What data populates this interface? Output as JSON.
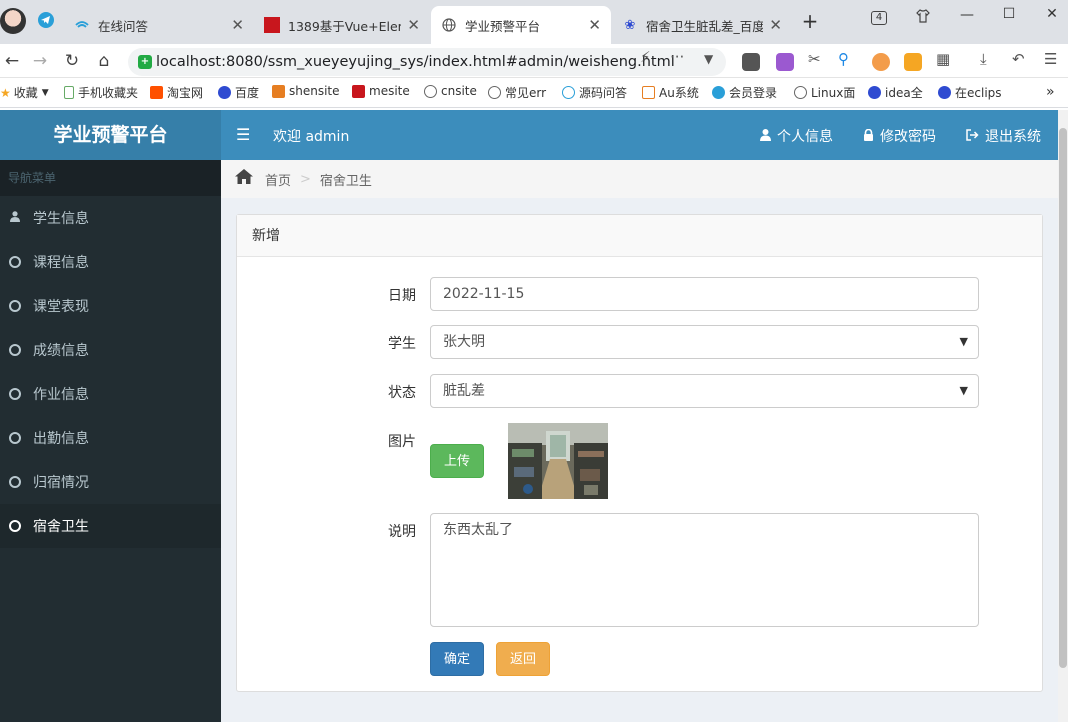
{
  "browser": {
    "tabs": [
      {
        "title": "在线问答"
      },
      {
        "title": "1389基于Vue+Eleme"
      },
      {
        "title": "学业预警平台"
      },
      {
        "title": "宿舍卫生脏乱差_百度"
      }
    ],
    "tab_count": "4",
    "url": "localhost:8080/ssm_xueyeyujing_sys/index.html#admin/weisheng.html",
    "bookmarks": [
      "收藏",
      "手机收藏夹",
      "淘宝网",
      "百度",
      "shensite",
      "mesite",
      "cnsite",
      "常见err",
      "源码问答",
      "Au系统",
      "会员登录",
      "Linux面",
      "idea全",
      "在eclips"
    ]
  },
  "header": {
    "brand": "学业预警平台",
    "welcome": "欢迎 admin",
    "profile": "个人信息",
    "change_password": "修改密码",
    "logout": "退出系统"
  },
  "sidebar": {
    "header": "导航菜单",
    "items": [
      {
        "label": "学生信息"
      },
      {
        "label": "课程信息"
      },
      {
        "label": "课堂表现"
      },
      {
        "label": "成绩信息"
      },
      {
        "label": "作业信息"
      },
      {
        "label": "出勤信息"
      },
      {
        "label": "归宿情况"
      },
      {
        "label": "宿舍卫生"
      }
    ]
  },
  "breadcrumb": {
    "home": "首页",
    "current": "宿舍卫生"
  },
  "form": {
    "title": "新增",
    "date_label": "日期",
    "date_value": "2022-11-15",
    "student_label": "学生",
    "student_value": "张大明",
    "status_label": "状态",
    "status_value": "脏乱差",
    "image_label": "图片",
    "upload_label": "上传",
    "desc_label": "说明",
    "desc_value": "东西太乱了",
    "ok_label": "确定",
    "back_label": "返回"
  }
}
